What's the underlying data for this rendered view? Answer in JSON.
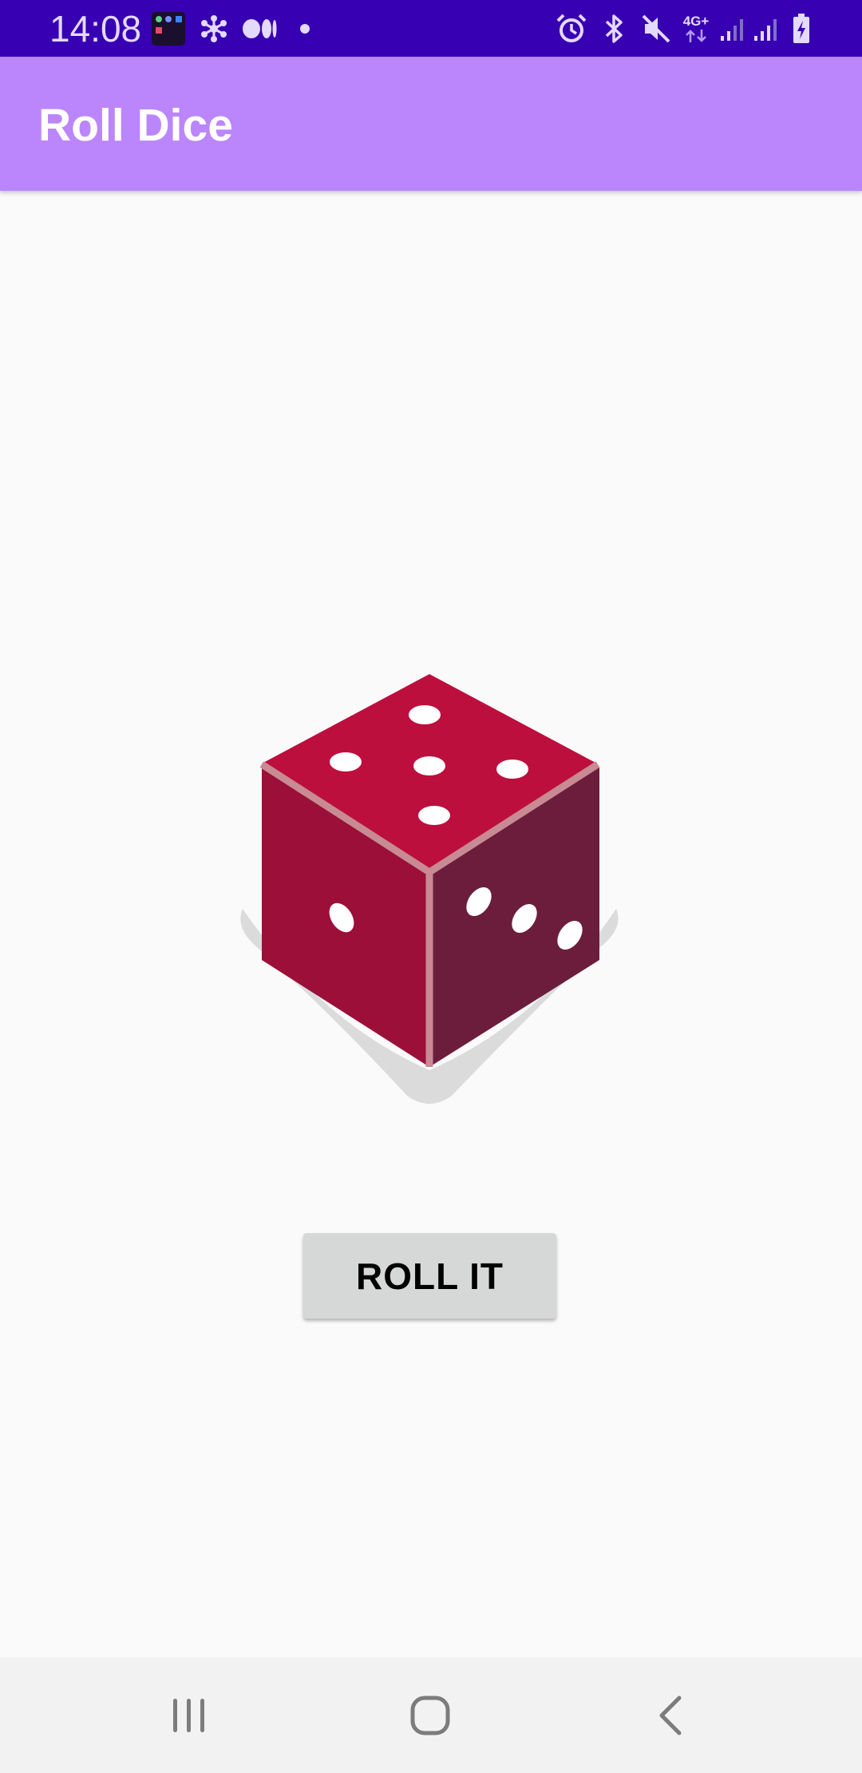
{
  "status_bar": {
    "time": "14:08",
    "network_label": "4G+",
    "background_color": "#3700B3",
    "icons": [
      "app-grid-notification-icon",
      "connected-network-icon",
      "medium-app-icon",
      "notification-dot-icon",
      "alarm-icon",
      "bluetooth-icon",
      "mute-icon",
      "4g-plus-data-icon",
      "signal-strength-icon",
      "signal-strength-2-icon",
      "battery-charging-icon"
    ]
  },
  "app_bar": {
    "title": "Roll Dice",
    "background_color": "#BB86FC"
  },
  "dice": {
    "icon": "dice-icon",
    "top_face_pips": 5,
    "left_face_pips": 1,
    "right_face_pips": 3,
    "colors": {
      "top": "#BC0F3D",
      "left": "#9B0F38",
      "right": "#6C1D3C"
    }
  },
  "button": {
    "label": "ROLL IT"
  },
  "nav_bar": {
    "buttons": [
      "recent-apps-icon",
      "home-icon",
      "back-icon"
    ]
  }
}
